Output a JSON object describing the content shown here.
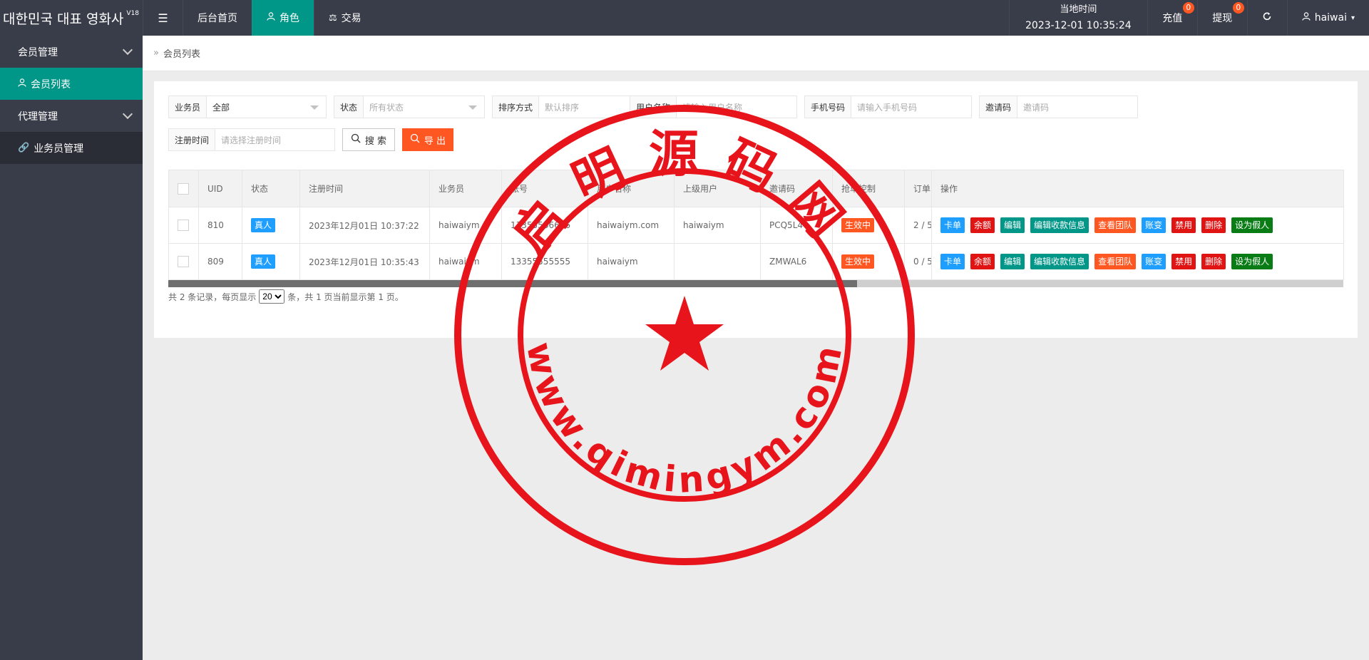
{
  "app": {
    "brand": "대한민국 대표 영화사",
    "version": "V18"
  },
  "topnav": {
    "menu_icon": "menu-fold-icon",
    "items": [
      {
        "label": "后台首页",
        "icon": ""
      },
      {
        "label": "角色",
        "icon": "user-icon",
        "active": true
      },
      {
        "label": "交易",
        "icon": "scale-icon"
      }
    ]
  },
  "topright": {
    "time_label": "当地时间",
    "time_value": "2023-12-01 10:35:24",
    "recharge_label": "充值",
    "recharge_badge": "0",
    "withdraw_label": "提现",
    "withdraw_badge": "0",
    "refresh_icon": "refresh-icon",
    "user_name": "haiwai"
  },
  "sidebar": {
    "groups": [
      {
        "label": "会员管理",
        "children": [
          {
            "label": "会员列表",
            "icon": "user-icon",
            "active": true
          }
        ]
      },
      {
        "label": "代理管理",
        "children": [
          {
            "label": "业务员管理",
            "icon": "link-icon"
          }
        ]
      }
    ]
  },
  "breadcrumb": {
    "label": "会员列表"
  },
  "filters": {
    "salesman": {
      "label": "业务员",
      "value": "全部"
    },
    "status": {
      "label": "状态",
      "placeholder": "所有状态"
    },
    "sort": {
      "label": "排序方式",
      "placeholder": "默认排序"
    },
    "username": {
      "label": "用户名称",
      "placeholder": "请输入用户名称"
    },
    "phone": {
      "label": "手机号码",
      "placeholder": "请输入手机号码"
    },
    "invite": {
      "label": "邀请码",
      "placeholder": "邀请码"
    },
    "regtime": {
      "label": "注册时间",
      "placeholder": "请选择注册时间"
    },
    "search_button": "搜 索",
    "export_button": "导 出"
  },
  "table": {
    "headers": [
      "UID",
      "状态",
      "注册时间",
      "业务员",
      "账号",
      "用户名称",
      "上级用户",
      "邀请码",
      "抢单控制",
      "订单",
      "操作"
    ],
    "rows": [
      {
        "uid": "810",
        "status": "真人",
        "regtime": "2023年12月01日 10:37:22",
        "salesman": "haiwaiym",
        "account": "13355566666",
        "username": "haiwaiym.com",
        "parent": "haiwaiym",
        "invite": "PCQ5L4",
        "control": "生效中",
        "orders": "2 / 5"
      },
      {
        "uid": "809",
        "status": "真人",
        "regtime": "2023年12月01日 10:35:43",
        "salesman": "haiwaiym",
        "account": "13355555555",
        "username": "haiwaiym",
        "parent": "",
        "invite": "ZMWAL6",
        "control": "生效中",
        "orders": "0 / 5"
      }
    ],
    "ops": [
      "卡单",
      "余额",
      "编辑",
      "编辑收款信息",
      "查看团队",
      "账变",
      "禁用",
      "删除",
      "设为假人"
    ]
  },
  "pager": {
    "prefix": "共 2 条记录，每页显示",
    "per_page": "20",
    "suffix": "条，共 1 页当前显示第 1 页。"
  },
  "stamp": {
    "top_text": "启明源码网",
    "bottom_text": "www.qimingym.com",
    "color": "#e8141b"
  }
}
